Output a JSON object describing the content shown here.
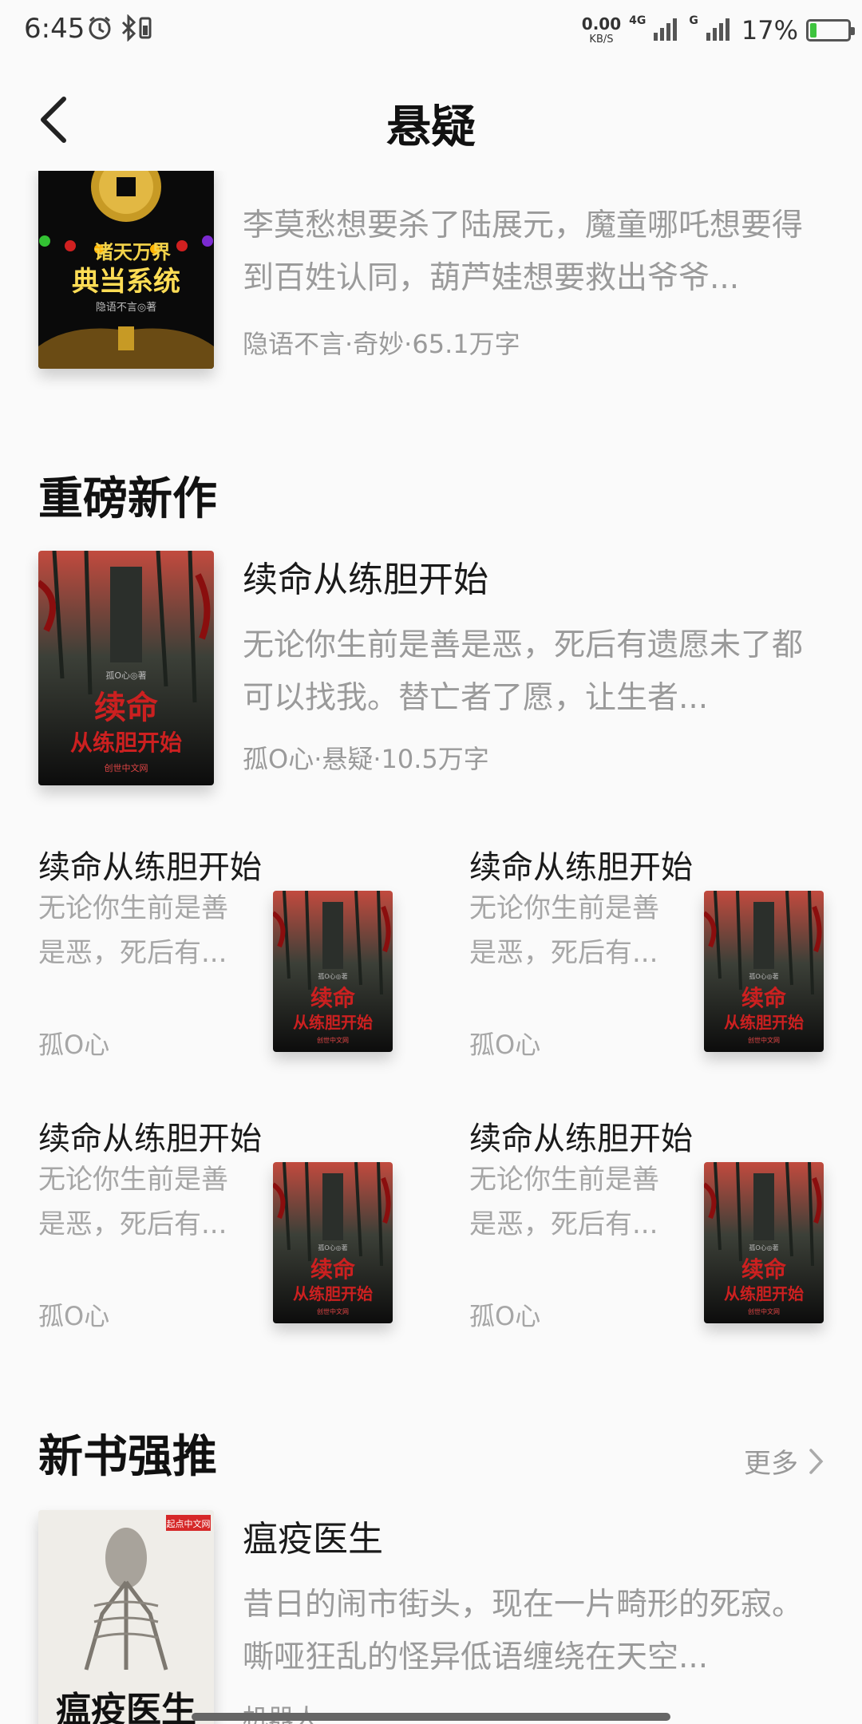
{
  "status_bar": {
    "time": "6:45",
    "net_speed": "0.00",
    "net_unit": "KB/S",
    "sig1_label": "4G",
    "sig2_label": "G",
    "battery_pct": "17%",
    "battery_level": 0.17
  },
  "header": {
    "title": "悬疑"
  },
  "top_book": {
    "desc": "李莫愁想要杀了陆展元，魔童哪吒想要得到百姓认同，葫芦娃想要救出爷爷...",
    "meta": "隐语不言·奇妙·65.1万字",
    "cover": {
      "line1": "诸天万界",
      "line2": "典当系统",
      "author": "隐语不言◎著"
    }
  },
  "section_new": {
    "title": "重磅新作",
    "featured": {
      "title": "续命从练胆开始",
      "desc": "无论你生前是善是恶，死后有遗愿未了都可以找我。替亡者了愿，让生者...",
      "meta": "孤O心·悬疑·10.5万字",
      "cover": {
        "line1": "续命",
        "line2": "从练胆开始",
        "author": "孤O心◎著",
        "publisher": "创世中文网"
      }
    },
    "grid": [
      {
        "title": "续命从练胆开始",
        "desc": "无论你生前是善是恶，死后有...",
        "author": "孤O心"
      },
      {
        "title": "续命从练胆开始",
        "desc": "无论你生前是善是恶，死后有...",
        "author": "孤O心"
      },
      {
        "title": "续命从练胆开始",
        "desc": "无论你生前是善是恶，死后有...",
        "author": "孤O心"
      },
      {
        "title": "续命从练胆开始",
        "desc": "无论你生前是善是恶，死后有...",
        "author": "孤O心"
      }
    ]
  },
  "section_push": {
    "title": "新书强推",
    "more_label": "更多",
    "featured": {
      "title": "瘟疫医生",
      "desc": "昔日的闹市街头，现在一片畸形的死寂。嘶哑狂乱的怪异低语缠绕在天空...",
      "meta": "机器人...",
      "cover": {
        "line1": "瘟疫医生",
        "badge": "起点中文网"
      }
    }
  },
  "colors": {
    "background": "#fafafa",
    "title": "#111111",
    "muted": "#9a9a9a",
    "battery_green": "#3ec43e"
  }
}
